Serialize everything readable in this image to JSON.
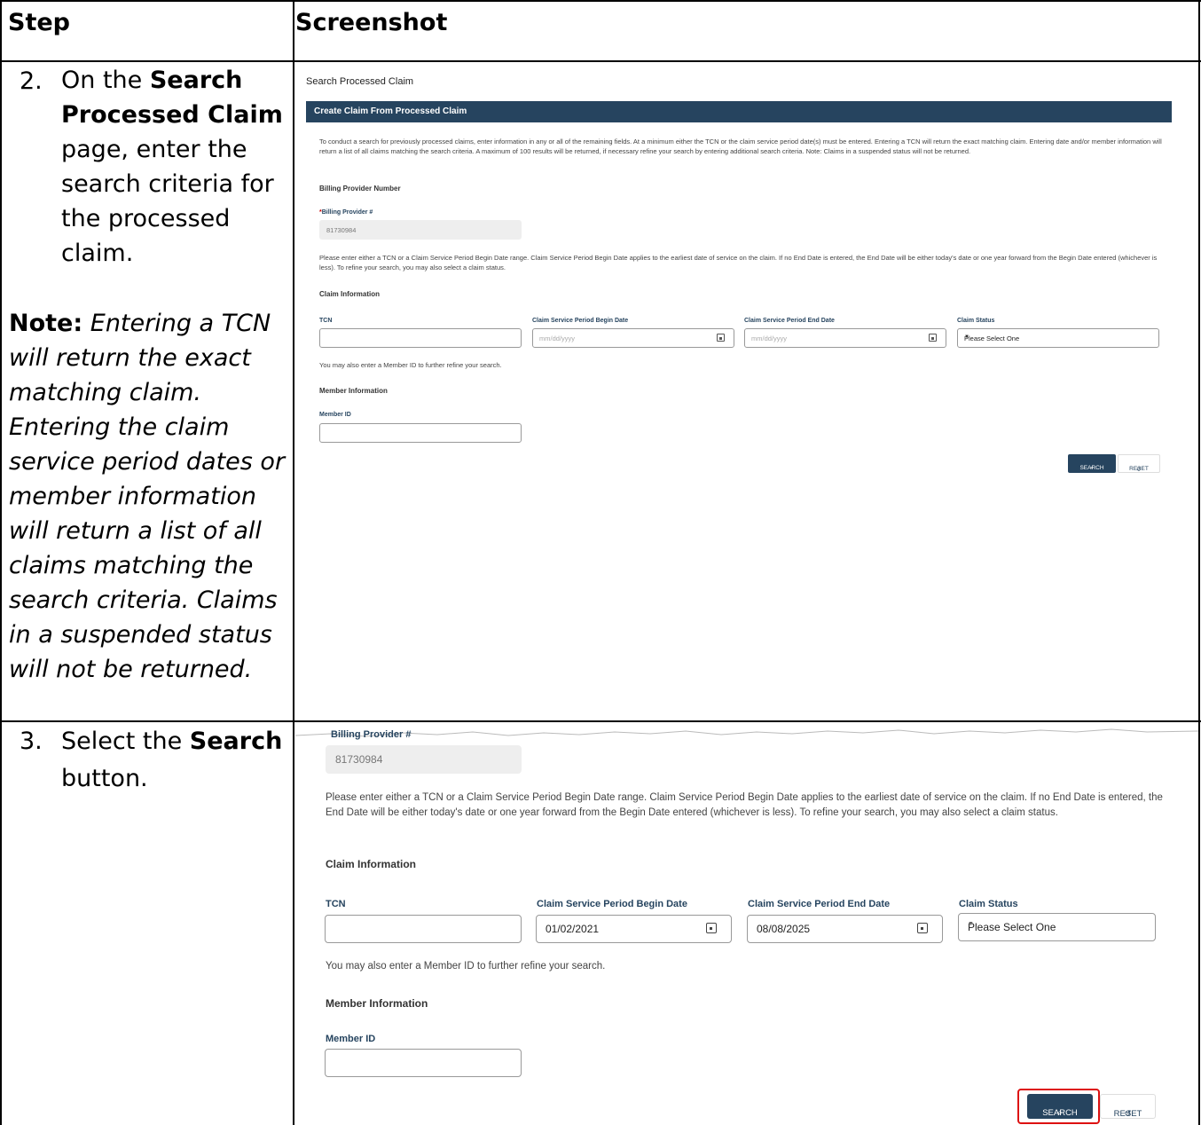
{
  "table": {
    "header_step": "Step",
    "header_screenshot": "Screenshot"
  },
  "step2": {
    "number": "2.",
    "text_pre": "On the ",
    "text_bold": "Search Processed Claim",
    "text_post": " page, enter the search criteria for the processed claim.",
    "note_label": "Note:",
    "note_text": " Entering a TCN will return the exact matching claim. Entering the claim service period dates or member information will return a list of all claims matching the search criteria. Claims in a suspended status will not be returned."
  },
  "step3": {
    "number": "3.",
    "text_pre": "Select the ",
    "text_bold": "Search",
    "text_post": " button."
  },
  "screen1": {
    "page_title": "Search Processed Claim",
    "bar_title": "Create Claim From Processed Claim",
    "intro": "To conduct a search for previously processed claims, enter information in any or all of the remaining fields. At a minimum either the TCN or the claim service period date(s) must be entered. Entering a TCN will return the exact matching claim. Entering date and/or member information will return a list of all claims matching the search criteria. A maximum of 100 results will be returned, if necessary refine your search by entering additional search criteria. Note: Claims in a suspended status will not be returned.",
    "billing_section": "Billing Provider Number",
    "billing_label": "Billing Provider #",
    "billing_required": "*",
    "billing_value": "81730984",
    "date_info": "Please enter either a TCN or a Claim Service Period Begin Date range. Claim Service Period Begin Date applies to the earliest date of service on the claim. If no End Date is entered, the End Date will be either today's date or one year forward from the Begin Date entered (whichever is less). To refine your search, you may also select a claim status.",
    "claim_section": "Claim Information",
    "tcn_label": "TCN",
    "begin_label": "Claim Service Period Begin Date",
    "begin_placeholder": "mm/dd/yyyy",
    "end_label": "Claim Service Period End Date",
    "end_placeholder": "mm/dd/yyyy",
    "status_label": "Claim Status",
    "status_value": "Please Select One",
    "member_hint": "You may also enter a Member ID to further refine your search.",
    "member_section": "Member Information",
    "member_label": "Member ID",
    "search_button": "SEARCH",
    "reset_button": "RESET"
  },
  "screen2": {
    "billing_label": "Billing Provider #",
    "billing_value": "81730984",
    "date_info": "Please enter either a TCN or a Claim Service Period Begin Date range. Claim Service Period Begin Date applies to the earliest date of service on the claim. If no End Date is entered, the End Date will be either today's date or one year forward from the Begin Date entered (whichever is less). To refine your search, you may also select a claim status.",
    "claim_section": "Claim Information",
    "tcn_label": "TCN",
    "begin_label": "Claim Service Period Begin Date",
    "begin_value": "01/02/2021",
    "end_label": "Claim Service Period End Date",
    "end_value": "08/08/2025",
    "status_label": "Claim Status",
    "status_value": "Please Select One",
    "member_hint": "You may also enter a Member ID to further refine your search.",
    "member_section": "Member Information",
    "member_label": "Member ID",
    "search_button": "SEARCH",
    "reset_button": "RESET"
  },
  "colors": {
    "brand": "#26445f",
    "highlight": "#dd1111"
  },
  "icons": {
    "search": "search-icon",
    "reset": "reset-icon",
    "calendar": "calendar-icon",
    "caret": "chevron-down-icon"
  }
}
